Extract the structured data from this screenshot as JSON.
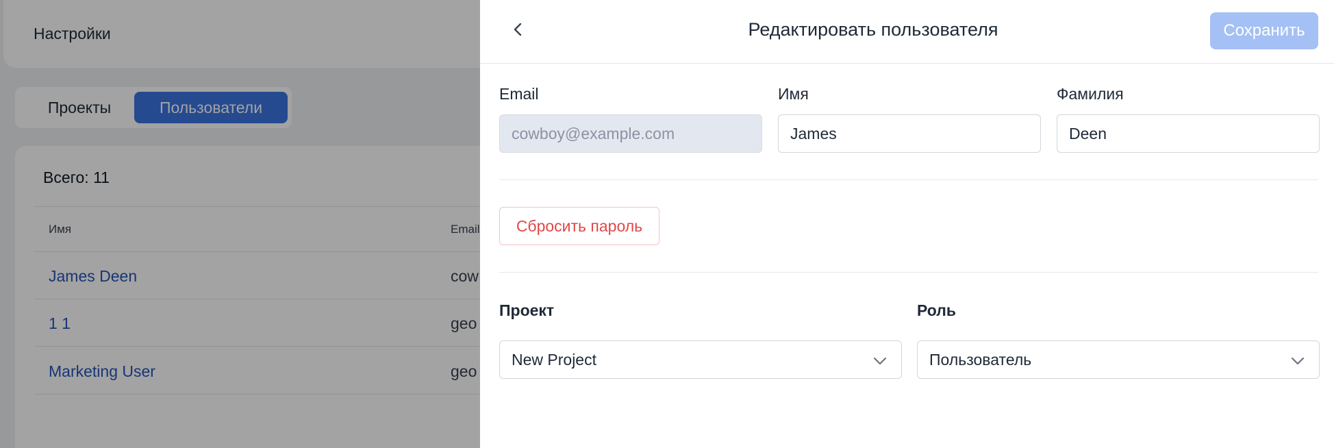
{
  "background": {
    "header_title": "Настройки",
    "tabs": [
      {
        "label": "Проекты",
        "active": false
      },
      {
        "label": "Пользователи",
        "active": true
      }
    ],
    "total_label": "Всего: 11",
    "columns": [
      "Имя",
      "Email"
    ],
    "rows": [
      {
        "name": "James Deen",
        "email": "cow"
      },
      {
        "name": "1 1",
        "email": "geo"
      },
      {
        "name": "Marketing User",
        "email": "geo"
      }
    ]
  },
  "drawer": {
    "title": "Редактировать пользователя",
    "save_label": "Сохранить",
    "fields": {
      "email": {
        "label": "Email",
        "value": "cowboy@example.com",
        "disabled": true
      },
      "first_name": {
        "label": "Имя",
        "value": "James"
      },
      "last_name": {
        "label": "Фамилия",
        "value": "Deen"
      }
    },
    "reset_password_label": "Сбросить пароль",
    "project": {
      "label": "Проект",
      "selected": "New Project"
    },
    "role": {
      "label": "Роль",
      "selected": "Пользователь"
    }
  },
  "colors": {
    "accent": "#3b74e0",
    "save_disabled": "#a4c0f4",
    "danger": "#e04848",
    "link": "#2554b8"
  },
  "icons": [
    "chevron-left-icon",
    "chevron-down-icon"
  ]
}
